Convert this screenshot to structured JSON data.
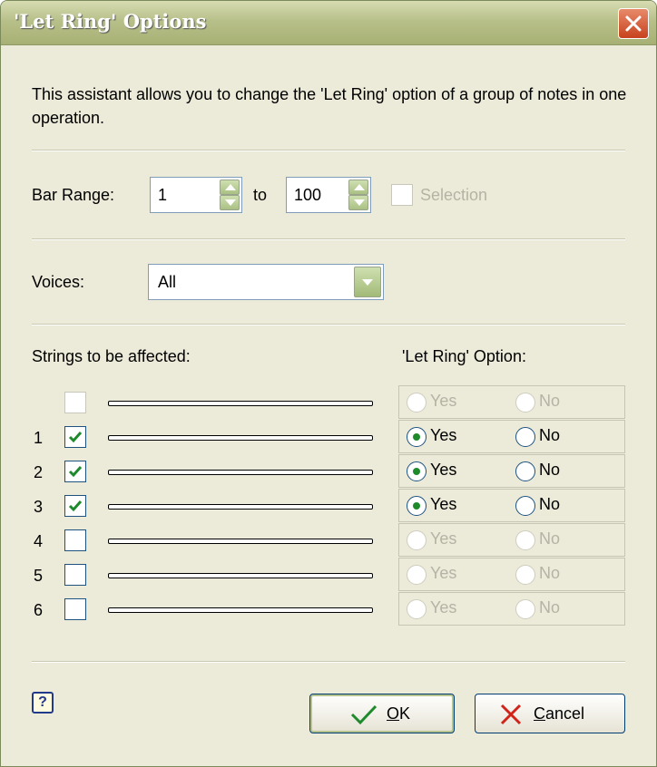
{
  "window": {
    "title": "'Let Ring' Options",
    "close": "×"
  },
  "description": "This assistant allows you to change the 'Let Ring' option of a group of notes in one operation.",
  "bar_range": {
    "label": "Bar Range:",
    "from": "1",
    "to_label": "to",
    "to": "100",
    "selection_label": "Selection"
  },
  "voices": {
    "label": "Voices:",
    "value": "All"
  },
  "strings": {
    "header": "Strings to be affected:",
    "option_header": "'Let Ring' Option:",
    "yes_label": "Yes",
    "no_label": "No",
    "rows": [
      {
        "num": "",
        "checked": false,
        "enabled": false,
        "yes": false
      },
      {
        "num": "1",
        "checked": true,
        "enabled": true,
        "yes": true
      },
      {
        "num": "2",
        "checked": true,
        "enabled": true,
        "yes": true
      },
      {
        "num": "3",
        "checked": true,
        "enabled": true,
        "yes": true
      },
      {
        "num": "4",
        "checked": false,
        "enabled": false,
        "yes": false
      },
      {
        "num": "5",
        "checked": false,
        "enabled": false,
        "yes": false
      },
      {
        "num": "6",
        "checked": false,
        "enabled": false,
        "yes": false
      }
    ]
  },
  "buttons": {
    "ok_prefix": "",
    "ok_mnemonic": "O",
    "ok_rest": "K",
    "cancel_mnemonic": "C",
    "cancel_rest": "ancel",
    "help": "?"
  },
  "colors": {
    "accent": "#1e8a2c",
    "title_bar": "#a7b074",
    "close": "#c8421e",
    "dialog_bg": "#ecead8"
  }
}
